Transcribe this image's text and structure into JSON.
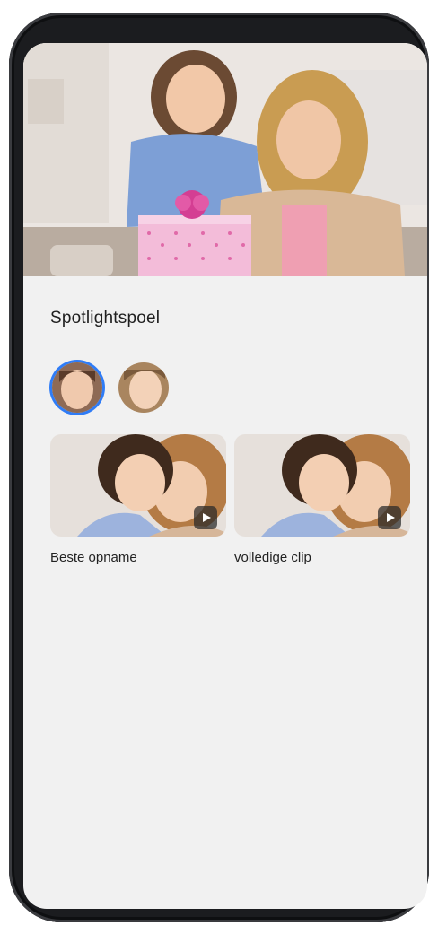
{
  "screen": {
    "hero_image": "mother-daughter-gift-photo",
    "section_title": "Spotlightspoel",
    "faces": [
      {
        "name": "girl-face",
        "selected": true
      },
      {
        "name": "woman-face",
        "selected": false
      }
    ],
    "clips": [
      {
        "label": "Beste opname",
        "icon": "play-icon"
      },
      {
        "label": "volledige clip",
        "icon": "play-icon"
      }
    ]
  },
  "colors": {
    "accent": "#2f7cf6",
    "background": "#f1f1f1",
    "frame": "#1b1c1f"
  }
}
